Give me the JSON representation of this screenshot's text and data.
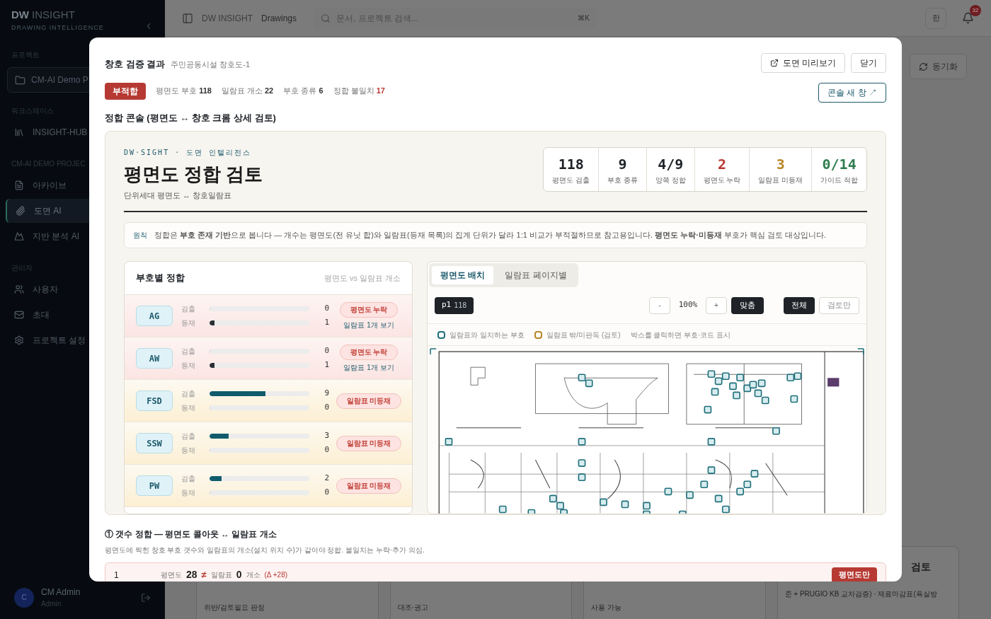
{
  "sidebar": {
    "brand": "DW",
    "brand_rest": "INSIGHT",
    "tagline": "DRAWING INTELLIGENCE",
    "project_heading": "프로젝트",
    "project": "CM-AI Demo P",
    "groups": [
      {
        "heading": "워크스페이스",
        "items": [
          {
            "label": "INSIGHT-HUB",
            "selected": false
          }
        ]
      },
      {
        "heading": "CM-AI DEMO PROJEC",
        "items": [
          {
            "label": "아카이브",
            "selected": false
          },
          {
            "label": "도면 AI",
            "selected": true
          },
          {
            "label": "지반 분석 AI",
            "selected": false
          }
        ]
      },
      {
        "heading": "관리자",
        "items": [
          {
            "label": "사용자",
            "selected": false
          },
          {
            "label": "초대",
            "selected": false
          },
          {
            "label": "프로젝트 설정",
            "selected": false
          }
        ]
      }
    ],
    "user": {
      "initial": "C",
      "name": "CM Admin",
      "role": "Admin"
    }
  },
  "topbar": {
    "breadcrumb": [
      "DW INSIGHT",
      "Drawings"
    ],
    "search": {
      "placeholder": "문서, 프로젝트 검색...",
      "shortcut": "⌘K"
    },
    "language": "한",
    "notifications": "32"
  },
  "background": {
    "sync_button": "동기화",
    "cards": [
      {
        "lines": [
          "위반/검토필요 판정"
        ]
      },
      {
        "lines": [
          "대조·권고"
        ]
      },
      {
        "lines": [
          "사용 가능"
        ]
      },
      {
        "title": "검토",
        "lines": [
          "준 + PRUGIO KB 교차검증) · 재료마감표(욕실방"
        ]
      }
    ]
  },
  "modal": {
    "title": "창호 검증 결과",
    "subtitle": "주민공동시설 창호도-1",
    "preview_button": "도면 미리보기",
    "close_button": "닫기",
    "console_button": "콘솔 새 창 ↗",
    "verdict": "부적합",
    "stats": [
      {
        "label": "평면도 부호",
        "value": "118",
        "kind": "plain"
      },
      {
        "label": "일람표 개소",
        "value": "22",
        "kind": "plain"
      },
      {
        "label": "부호 종류",
        "value": "6",
        "kind": "plain"
      },
      {
        "label": "정합 불일치",
        "value": "17",
        "kind": "alert"
      }
    ],
    "section_title": "정합 콘솔 (평면도 ↔ 창호 크롬 상세 검토)",
    "console": {
      "eyebrow": "DW·SIGHT · 도면 인텔리전스",
      "title": "평면도 정합 검토",
      "subtitle": "단위세대 평면도 ↔ 창호일람표",
      "kpis": [
        {
          "value": "118",
          "label": "평면도 검출",
          "color": "#1f2328"
        },
        {
          "value": "9",
          "label": "부호 종류",
          "color": "#1f2328"
        },
        {
          "value": "4/9",
          "label": "양쪽 정합",
          "color": "#1f2328"
        },
        {
          "value": "2",
          "label": "평면도 누락",
          "color": "#b83a32"
        },
        {
          "value": "3",
          "label": "일람표 미등재",
          "color": "#b7862a"
        },
        {
          "value": "0/14",
          "label": "가이드 적합",
          "color": "#2f7d4f"
        }
      ],
      "principle": {
        "tag": "원칙",
        "text": "정합은 **부호 존재 기반**으로 봅니다 — 개수는 평면도(전 유닛 합)와 일람표(등재 목록)의 집계 단위가 달라 1:1 비교가 부적절하므로 참고용입니다. **평면도 누락·미등재** 부호가 핵심 검토 대상입니다."
      },
      "code_table": {
        "title": "부호별 정합",
        "hint": "평면도 vs 일람표 개소",
        "rows": [
          {
            "code": "AG",
            "kind": "missing_plan",
            "bars": [
              {
                "label": "검출",
                "value": "0",
                "level": 0
              },
              {
                "label": "등재",
                "value": "1",
                "level": 0.05
              }
            ],
            "badge": "평면도 누락",
            "link": "일람표 1개 보기"
          },
          {
            "code": "AW",
            "kind": "missing_plan",
            "bars": [
              {
                "label": "검출",
                "value": "0",
                "level": 0
              },
              {
                "label": "등재",
                "value": "1",
                "level": 0.05
              }
            ],
            "badge": "평면도 누락",
            "link": "일람표 1개 보기"
          },
          {
            "code": "FSD",
            "kind": "unlisted",
            "bars": [
              {
                "label": "검출",
                "value": "9",
                "level": 0.56
              },
              {
                "label": "등재",
                "value": "0",
                "level": 0
              }
            ],
            "badge": "일람표 미등재"
          },
          {
            "code": "SSW",
            "kind": "unlisted",
            "bars": [
              {
                "label": "검출",
                "value": "3",
                "level": 0.19
              },
              {
                "label": "등재",
                "value": "0",
                "level": 0
              }
            ],
            "badge": "일람표 미등재"
          },
          {
            "code": "PW",
            "kind": "unlisted",
            "bars": [
              {
                "label": "검출",
                "value": "2",
                "level": 0.12
              },
              {
                "label": "등재",
                "value": "0",
                "level": 0
              }
            ],
            "badge": "일람표 미등재"
          }
        ]
      },
      "viewer": {
        "tabs": [
          {
            "label": "평면도 배치",
            "selected": true
          },
          {
            "label": "일람표 페이지별",
            "selected": false
          }
        ],
        "page": "p1",
        "page_count": "118",
        "zoom_out": "-",
        "zoom": "100%",
        "zoom_in": "+",
        "fit": "맞춤",
        "filters": [
          {
            "label": "전체",
            "selected": true
          },
          {
            "label": "검토만",
            "selected": false
          }
        ],
        "legend": [
          {
            "label": "일람표와 일치하는 부호",
            "color": "#1f6f7a"
          },
          {
            "label": "일람표 밖/미판독 (검토)",
            "color": "#b7862a"
          }
        ],
        "hint": "박스를 클릭하면 부호·코드 표시"
      }
    },
    "count_section": {
      "title": "① 갯수 정합 — 평면도 콜아웃 ↔ 일람표 개소",
      "description": "평면도에 찍힌 창호 부호 갯수와 일람표의 개소(설치 위치 수)가 같아야 정합. 불일치는 누락·추가 의심.",
      "rows": [
        {
          "index": "1",
          "plan_label": "평면도",
          "plan_value": "28",
          "neq": "≠",
          "schedule_label": "일람표",
          "schedule_value": "0",
          "unit": "개소",
          "delta": "(Δ +28)",
          "badge": "평면도만"
        }
      ]
    }
  }
}
